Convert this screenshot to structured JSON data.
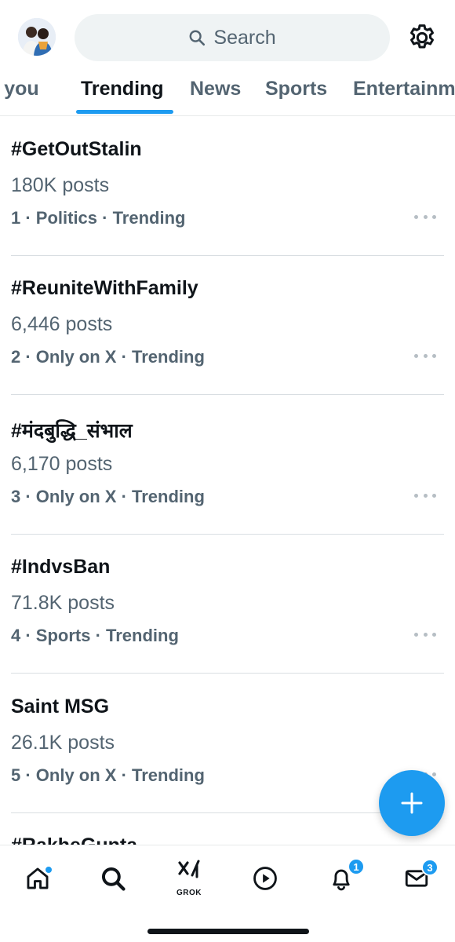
{
  "header": {
    "search_placeholder": "Search"
  },
  "tabs": [
    {
      "label": "For you"
    },
    {
      "label": "Trending",
      "active": true
    },
    {
      "label": "News"
    },
    {
      "label": "Sports"
    },
    {
      "label": "Entertainment"
    }
  ],
  "trends": [
    {
      "name": "#GetOutStalin",
      "posts": "180K posts",
      "meta": "1 · Politics · Trending"
    },
    {
      "name": "#ReuniteWithFamily",
      "posts": "6,446 posts",
      "meta": "2 · Only on X · Trending"
    },
    {
      "name": "#मंदबुद्धि_संभाल",
      "posts": "6,170 posts",
      "meta": "3 · Only on X · Trending"
    },
    {
      "name": "#IndvsBan",
      "posts": "71.8K posts",
      "meta": "4 · Sports · Trending"
    },
    {
      "name": "Saint MSG",
      "posts": "26.1K posts",
      "meta": "5 · Only on X · Trending"
    },
    {
      "name": "#RakheGunta",
      "posts": "",
      "meta": ""
    }
  ],
  "nav": {
    "grok_label": "GROK",
    "notifications_count": "1",
    "messages_count": "3"
  },
  "colors": {
    "accent": "#1d9bf0",
    "text_primary": "#0f1419",
    "text_secondary": "#536471"
  }
}
